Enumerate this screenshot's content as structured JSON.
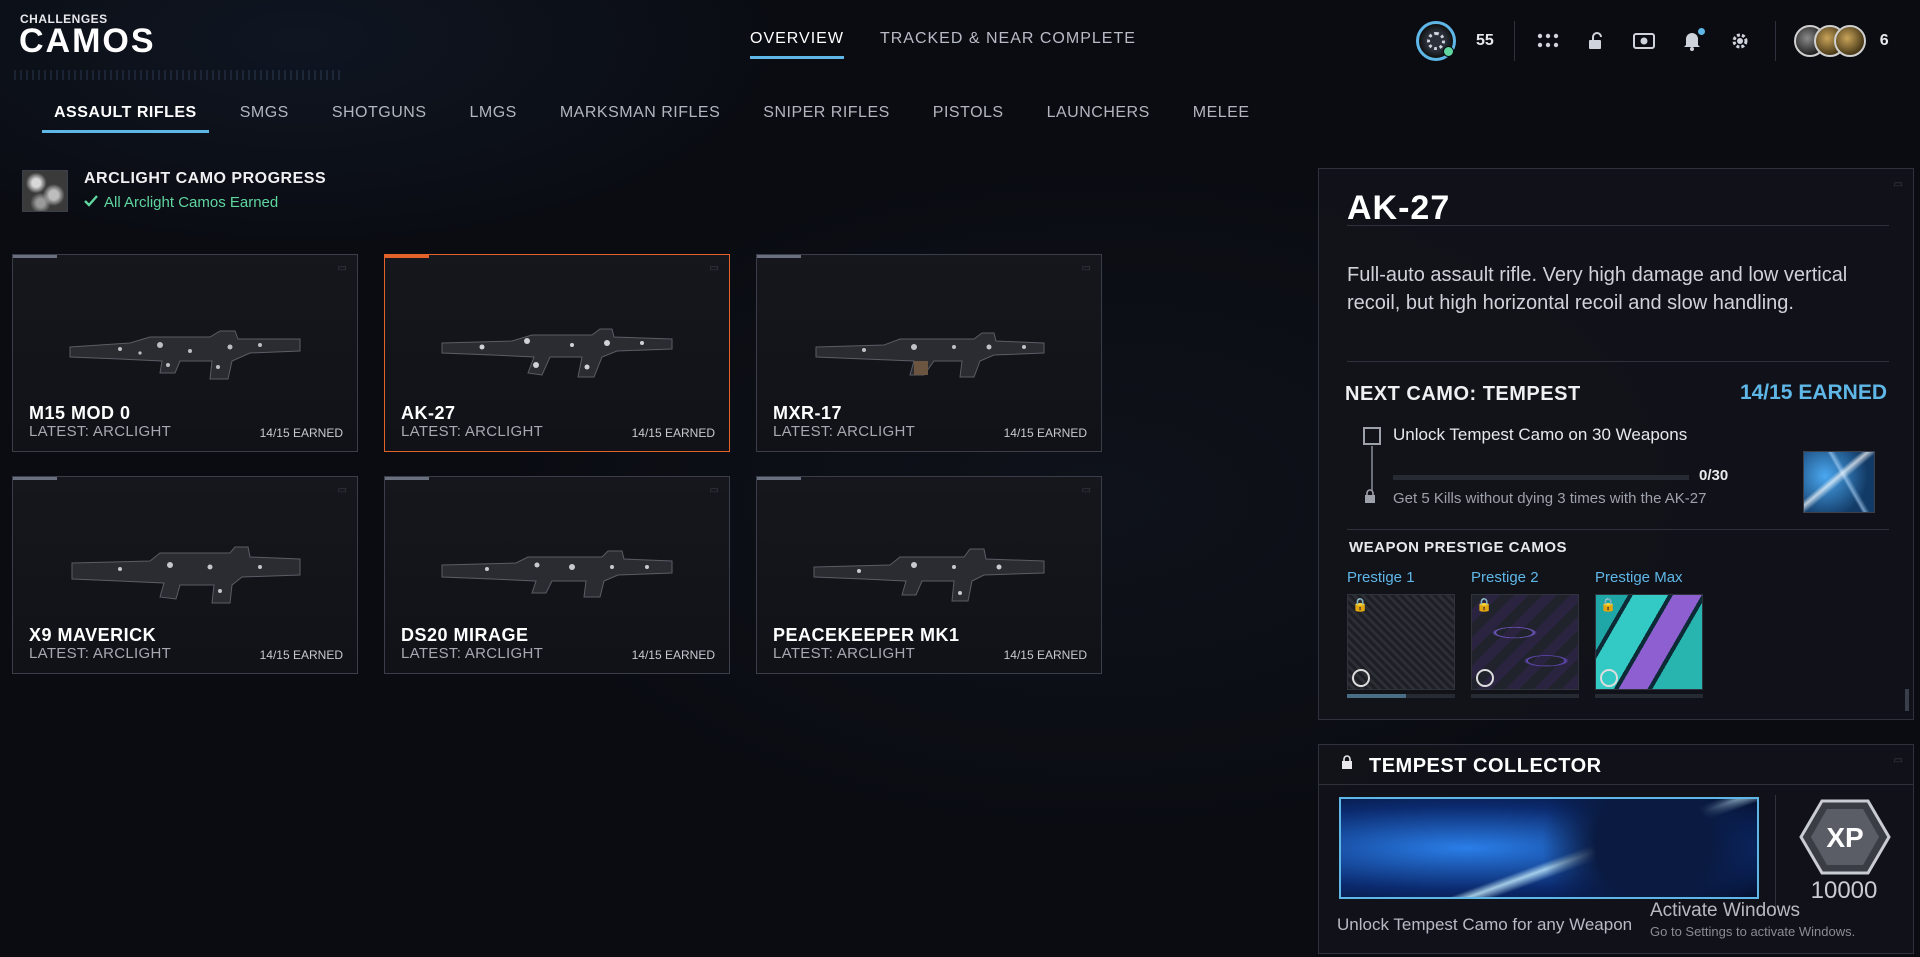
{
  "header": {
    "breadcrumb": "CHALLENGES",
    "title": "CAMOS",
    "tabs": [
      {
        "label": "OVERVIEW",
        "active": true
      },
      {
        "label": "TRACKED & NEAR COMPLETE",
        "active": false
      }
    ],
    "token_count": "55",
    "avatar_count": "6",
    "icons": [
      "token-icon",
      "grid-icon",
      "unlock-icon",
      "theater-icon",
      "bell-icon",
      "gear-icon"
    ]
  },
  "categories": [
    {
      "label": "ASSAULT RIFLES",
      "active": true
    },
    {
      "label": "SMGS"
    },
    {
      "label": "SHOTGUNS"
    },
    {
      "label": "LMGS"
    },
    {
      "label": "MARKSMAN RIFLES"
    },
    {
      "label": "SNIPER RIFLES"
    },
    {
      "label": "PISTOLS"
    },
    {
      "label": "LAUNCHERS"
    },
    {
      "label": "MELEE"
    }
  ],
  "arclight": {
    "title": "ARCLIGHT CAMO PROGRESS",
    "status": "All Arclight Camos Earned"
  },
  "weapons": [
    {
      "name": "M15 MOD 0",
      "latest": "LATEST: ARCLIGHT",
      "earned": "14/15 EARNED"
    },
    {
      "name": "AK-27",
      "latest": "LATEST: ARCLIGHT",
      "earned": "14/15 EARNED",
      "selected": true
    },
    {
      "name": "MXR-17",
      "latest": "LATEST: ARCLIGHT",
      "earned": "14/15 EARNED"
    },
    {
      "name": "X9 MAVERICK",
      "latest": "LATEST: ARCLIGHT",
      "earned": "14/15 EARNED"
    },
    {
      "name": "DS20 MIRAGE",
      "latest": "LATEST: ARCLIGHT",
      "earned": "14/15 EARNED"
    },
    {
      "name": "PEACEKEEPER MK1",
      "latest": "LATEST: ARCLIGHT",
      "earned": "14/15 EARNED"
    }
  ],
  "detail": {
    "title": "AK-27",
    "description": "Full-auto assault rifle. Very high damage and low vertical recoil, but high horizontal recoil and slow handling.",
    "next_camo_label": "NEXT CAMO: TEMPEST",
    "next_camo_earned": "14/15 EARNED",
    "challenge": {
      "title": "Unlock Tempest Camo on 30 Weapons",
      "progress": "0/30",
      "progress_fraction": 0,
      "description": "Get 5 Kills without dying 3 times with the AK-27"
    },
    "prestige_label": "WEAPON PRESTIGE CAMOS",
    "prestige": [
      {
        "name": "Prestige 1",
        "progress_fraction": 0.55
      },
      {
        "name": "Prestige 2",
        "progress_fraction": 0
      },
      {
        "name": "Prestige Max",
        "progress_fraction": 0
      }
    ]
  },
  "collector": {
    "title": "TEMPEST COLLECTOR",
    "xp_label": "XP",
    "xp_value": "10000",
    "description": "Unlock Tempest Camo for any Weapon"
  },
  "watermark": {
    "title": "Activate Windows",
    "subtitle": "Go to Settings to activate Windows."
  },
  "colors": {
    "accent": "#5fb7e8",
    "selected_border": "#e2622a",
    "success": "#5fd6a0"
  }
}
